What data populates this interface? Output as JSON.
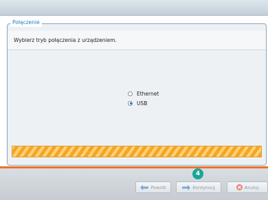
{
  "group": {
    "legend": "Połączenie",
    "instruction": "Wybierz tryb połączenia z urządzeniem."
  },
  "connection_options": [
    {
      "label": "Ethernet",
      "checked": false
    },
    {
      "label": "USB",
      "checked": true
    }
  ],
  "progress": {
    "percent": 100
  },
  "step_badge": "4",
  "buttons": {
    "back": {
      "label": "Powrót",
      "icon": "arrow-left-icon"
    },
    "next": {
      "label": "Kontynuuj",
      "icon": "arrow-right-icon"
    },
    "cancel": {
      "label": "Anuluj",
      "icon": "cancel-x-icon"
    }
  },
  "colors": {
    "accent_orange": "#e8742a",
    "legend_blue": "#1f7ec2",
    "badge_teal": "#1aa596",
    "progress_orange": "#f6a623"
  }
}
